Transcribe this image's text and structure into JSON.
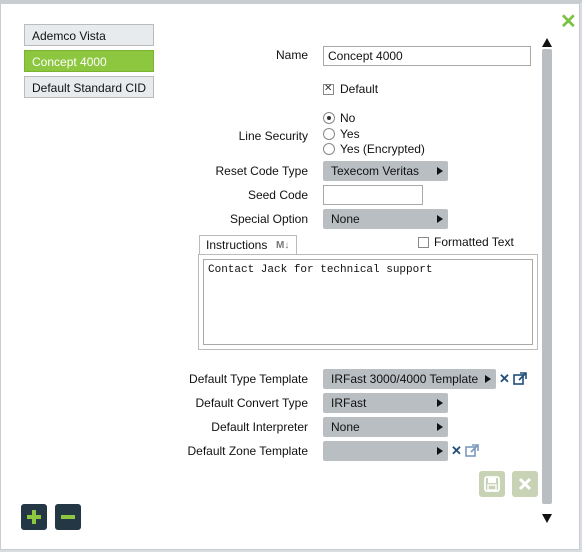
{
  "list": {
    "items": [
      {
        "label": "Ademco Vista",
        "selected": false
      },
      {
        "label": "Concept 4000",
        "selected": true
      },
      {
        "label": "Default Standard CID",
        "selected": false
      }
    ]
  },
  "form": {
    "name_label": "Name",
    "name_value": "Concept 4000",
    "default_label": "Default",
    "default_checked": true,
    "line_security_label": "Line Security",
    "line_security_options": [
      "No",
      "Yes",
      "Yes (Encrypted)"
    ],
    "line_security_selected": "No",
    "reset_code_type_label": "Reset Code Type",
    "reset_code_type_value": "Texecom Veritas",
    "seed_code_label": "Seed Code",
    "seed_code_value": "",
    "special_option_label": "Special Option",
    "special_option_value": "None",
    "instructions_tab_label": "Instructions",
    "formatted_text_label": "Formatted Text",
    "instructions_text": "Contact Jack for technical support",
    "default_type_template_label": "Default Type Template",
    "default_type_template_value": "IRFast 3000/4000 Template",
    "default_convert_type_label": "Default Convert Type",
    "default_convert_type_value": "IRFast",
    "default_interpreter_label": "Default Interpreter",
    "default_interpreter_value": "None",
    "default_zone_template_label": "Default Zone Template",
    "default_zone_template_value": ""
  },
  "icons": {
    "close": "close-icon",
    "add": "plus-icon",
    "remove": "minus-icon",
    "save": "floppy-disk-icon",
    "cancel": "cancel-icon",
    "sort": "sort-icon",
    "clear": "clear-icon",
    "open": "external-link-icon"
  },
  "colors": {
    "accent_green": "#8dc63f",
    "dark_button": "#243744",
    "select_gray": "#b9bec3",
    "icon_blue": "#1f4e79"
  }
}
